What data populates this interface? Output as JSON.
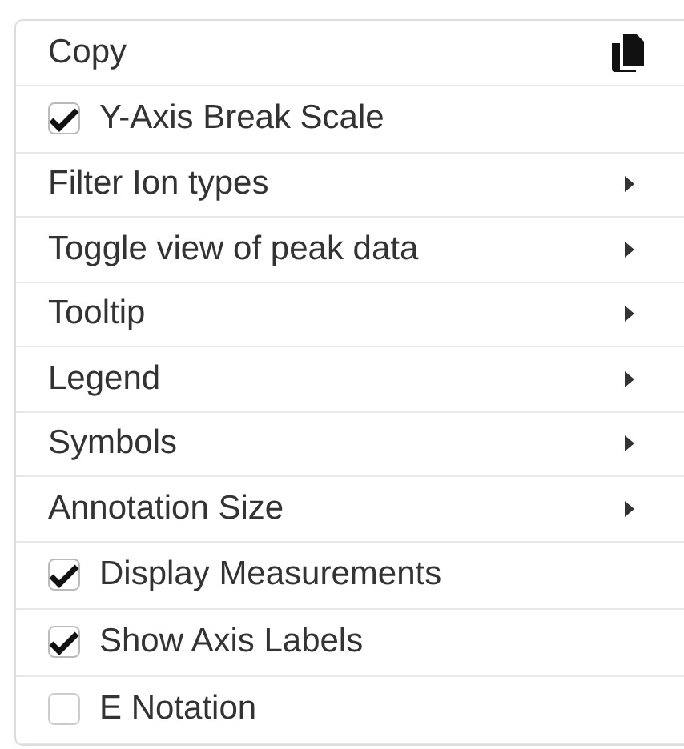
{
  "menu": {
    "items": [
      {
        "kind": "action",
        "label": "Copy"
      },
      {
        "kind": "check",
        "label": "Y-Axis Break Scale",
        "checked": true
      },
      {
        "kind": "submenu",
        "label": "Filter Ion types"
      },
      {
        "kind": "submenu",
        "label": "Toggle view of peak data"
      },
      {
        "kind": "submenu",
        "label": "Tooltip"
      },
      {
        "kind": "submenu",
        "label": "Legend"
      },
      {
        "kind": "submenu",
        "label": "Symbols"
      },
      {
        "kind": "submenu",
        "label": "Annotation Size"
      },
      {
        "kind": "check",
        "label": "Display Measurements",
        "checked": true
      },
      {
        "kind": "check",
        "label": "Show Axis Labels",
        "checked": true
      },
      {
        "kind": "check",
        "label": "E Notation",
        "checked": false
      }
    ]
  }
}
